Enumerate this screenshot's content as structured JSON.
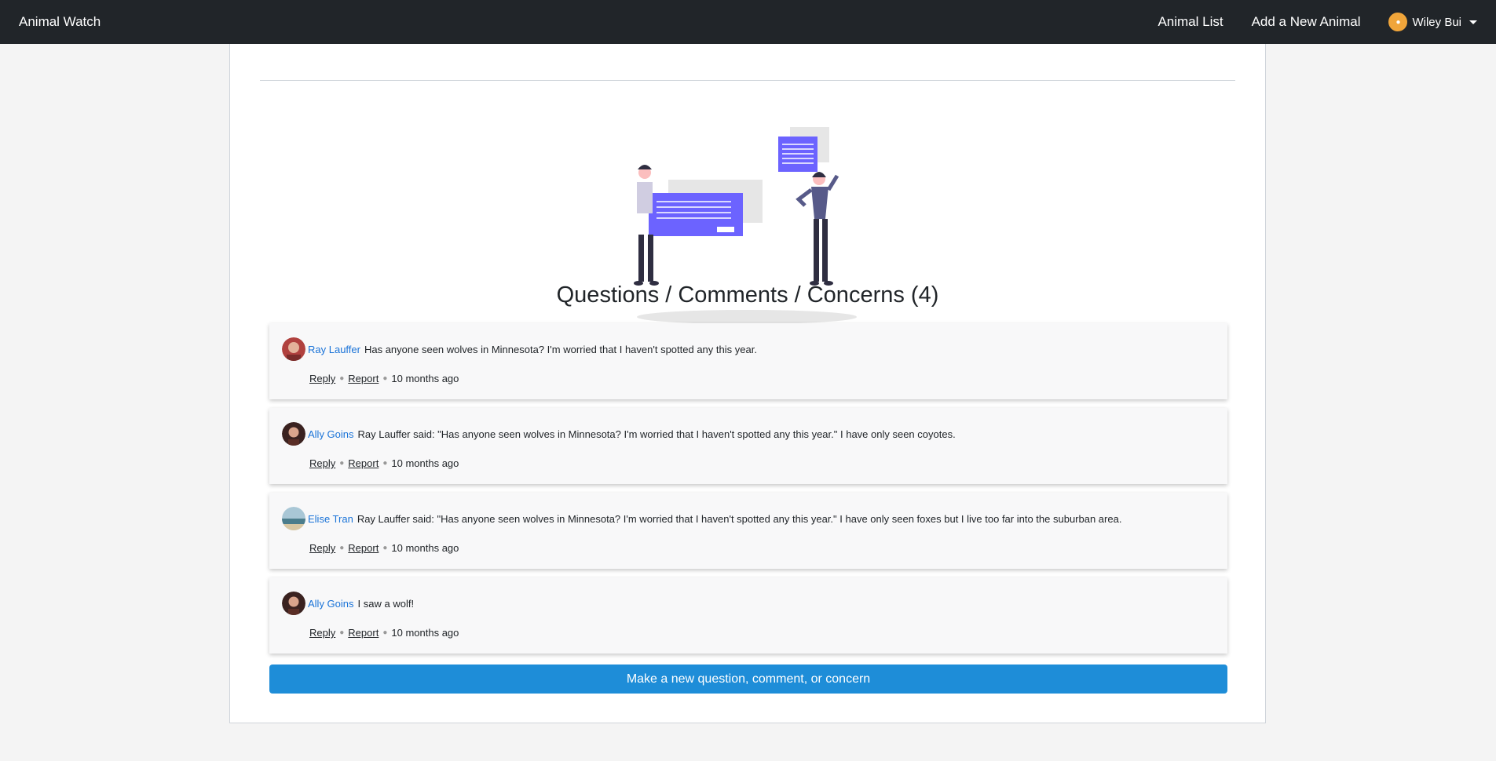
{
  "nav": {
    "brand": "Animal Watch",
    "links": [
      "Animal List",
      "Add a New Animal"
    ],
    "user_name": "Wiley Bui"
  },
  "section": {
    "heading": "Questions / Comments / Concerns (4)",
    "button_label": "Make a new question, comment, or concern"
  },
  "comments": [
    {
      "author": "Ray Lauffer",
      "text": "Has anyone seen wolves in Minnesota? I'm worried that I haven't spotted any this year.",
      "reply": "Reply",
      "report": "Report",
      "time": "10 months ago"
    },
    {
      "author": "Ally Goins",
      "text": "Ray Lauffer said: \"Has anyone seen wolves in Minnesota? I'm worried that I haven't spotted any this year.\" I have only seen coyotes.",
      "reply": "Reply",
      "report": "Report",
      "time": "10 months ago"
    },
    {
      "author": "Elise Tran",
      "text": "Ray Lauffer said: \"Has anyone seen wolves in Minnesota? I'm worried that I haven't spotted any this year.\" I have only seen foxes but I live too far into the suburban area.",
      "reply": "Reply",
      "report": "Report",
      "time": "10 months ago"
    },
    {
      "author": "Ally Goins",
      "text": "I saw a wolf!",
      "reply": "Reply",
      "report": "Report",
      "time": "10 months ago"
    }
  ],
  "colors": {
    "navbar": "#212529",
    "accent": "#1e8dd8",
    "author_link": "#1a73d8",
    "illustration_purple": "#6c63ff"
  }
}
